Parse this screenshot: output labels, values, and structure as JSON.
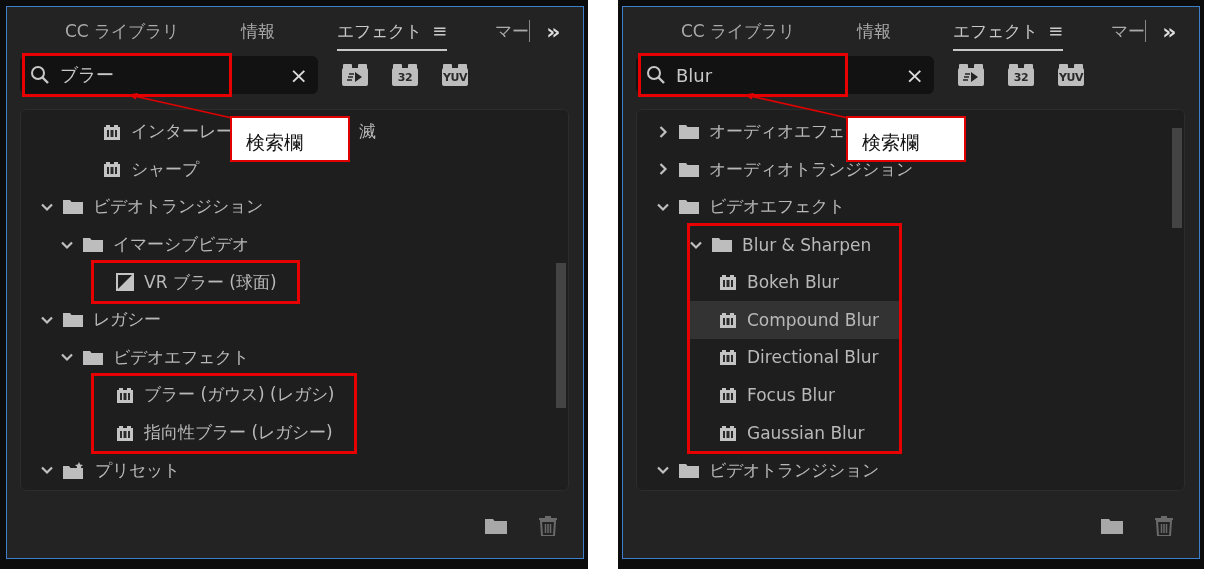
{
  "panels": [
    {
      "tabs": [
        {
          "label": "CC ライブラリ",
          "selected": false
        },
        {
          "label": "情報",
          "selected": false
        },
        {
          "label": "エフェクト",
          "selected": true,
          "menu": "≡"
        },
        {
          "label": "マー",
          "selected": false
        }
      ],
      "overflow": "»",
      "search": {
        "value": "ブラー",
        "clear": "×",
        "marked": true
      },
      "badges": [
        {
          "kind": "accelerated"
        },
        {
          "kind": "labelled",
          "text": "32"
        },
        {
          "kind": "labelled",
          "text": "YUV"
        }
      ],
      "tree": [
        {
          "kind": "continuation",
          "children": [
            {
              "kind": "continuation",
              "children": [
                {
                  "kind": "effect",
                  "label": "インターレー",
                  "label_tail": "滅",
                  "selected": false,
                  "marked": false
                },
                {
                  "kind": "effect",
                  "label": "シャープ",
                  "selected": false,
                  "marked": false
                }
              ]
            }
          ]
        },
        {
          "kind": "folder",
          "label": "ビデオトランジション",
          "expanded": true,
          "selected": false,
          "marked": false,
          "children": [
            {
              "kind": "folder",
              "label": "イマーシブビデオ",
              "expanded": true,
              "selected": false,
              "marked": false,
              "children": [
                {
                  "kind": "transition",
                  "label": "VR ブラー (球面)",
                  "selected": false,
                  "marked": true
                }
              ]
            }
          ]
        },
        {
          "kind": "folder",
          "label": "レガシー",
          "expanded": true,
          "selected": false,
          "marked": false,
          "children": [
            {
              "kind": "folder",
              "label": "ビデオエフェクト",
              "expanded": true,
              "selected": false,
              "marked": false,
              "children": [
                {
                  "kind": "effect",
                  "label": "ブラー (ガウス) (レガシ)",
                  "selected": false,
                  "marked": true
                },
                {
                  "kind": "effect",
                  "label": "指向性ブラー (レガシー)",
                  "selected": false,
                  "marked": true
                }
              ]
            }
          ]
        },
        {
          "kind": "preset-folder",
          "label": "プリセット",
          "expanded": true,
          "selected": false,
          "marked": false
        }
      ],
      "callout": "検索欄"
    },
    {
      "tabs": [
        {
          "label": "CC ライブラリ",
          "selected": false
        },
        {
          "label": "情報",
          "selected": false
        },
        {
          "label": "エフェクト",
          "selected": true,
          "menu": "≡"
        },
        {
          "label": "マー",
          "selected": false
        }
      ],
      "overflow": "»",
      "search": {
        "value": "Blur",
        "clear": "×",
        "marked": true
      },
      "badges": [
        {
          "kind": "accelerated"
        },
        {
          "kind": "labelled",
          "text": "32"
        },
        {
          "kind": "labelled",
          "text": "YUV"
        }
      ],
      "tree": [
        {
          "kind": "folder",
          "label": "オーディオエフェ",
          "expanded": false,
          "selected": false,
          "marked": false
        },
        {
          "kind": "folder",
          "label": "オーディオトランジション",
          "expanded": false,
          "selected": false,
          "marked": false
        },
        {
          "kind": "folder",
          "label": "ビデオエフェクト",
          "expanded": true,
          "selected": false,
          "marked": false,
          "children": [
            {
              "kind": "folder",
              "label": "Blur & Sharpen",
              "expanded": true,
              "selected": false,
              "marked": true,
              "children": [
                {
                  "kind": "effect",
                  "label": "Bokeh Blur",
                  "selected": false,
                  "marked": true
                },
                {
                  "kind": "effect",
                  "label": "Compound Blur",
                  "selected": true,
                  "marked": true
                },
                {
                  "kind": "effect",
                  "label": "Directional Blur",
                  "selected": false,
                  "marked": true
                },
                {
                  "kind": "effect",
                  "label": "Focus Blur",
                  "selected": false,
                  "marked": true
                },
                {
                  "kind": "effect",
                  "label": "Gaussian Blur",
                  "selected": false,
                  "marked": true
                }
              ]
            }
          ]
        },
        {
          "kind": "folder",
          "label": "ビデオトランジション",
          "expanded": true,
          "selected": false,
          "marked": false
        }
      ],
      "callout": "検索欄"
    }
  ]
}
